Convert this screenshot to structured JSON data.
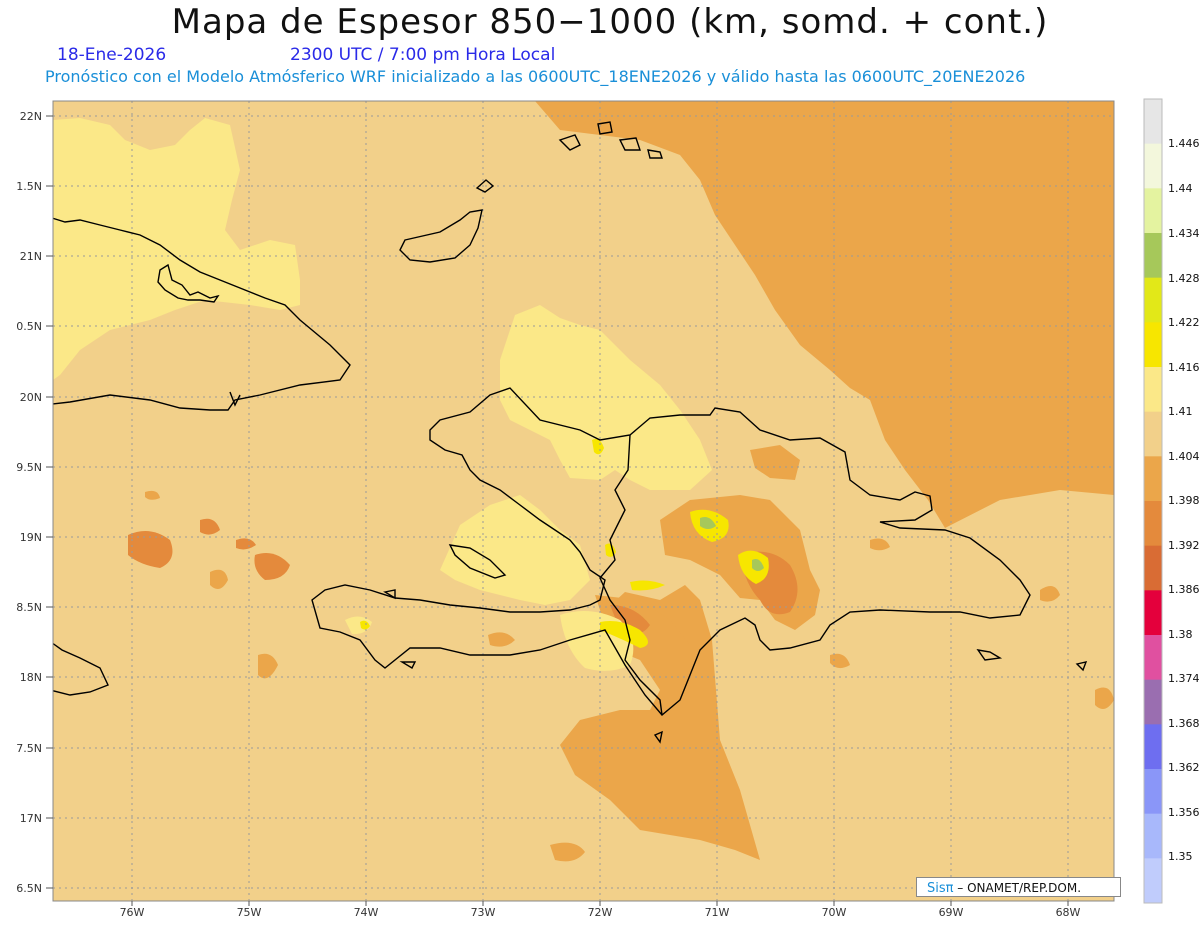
{
  "header": {
    "title": "Mapa de Espesor 850−1000 (km, somd. + cont.)",
    "date": "18-Ene-2026",
    "time": "2300 UTC / 7:00 pm Hora Local",
    "subtitle": "Pronóstico con el Modelo Atmósferico WRF inicializado a las 0600UTC_18ENE2026 y válido hasta las  0600UTC_20ENE2026"
  },
  "axes": {
    "lat_labels": [
      "22N",
      "1.5N",
      "21N",
      "0.5N",
      "20N",
      "9.5N",
      "19N",
      "8.5N",
      "18N",
      "7.5N",
      "17N",
      "6.5N"
    ],
    "lon_labels": [
      "76W",
      "75W",
      "74W",
      "73W",
      "72W",
      "71W",
      "70W",
      "69W",
      "68W"
    ]
  },
  "colorbar": {
    "labels": [
      "1.446",
      "1.44",
      "1.434",
      "1.428",
      "1.422",
      "1.416",
      "1.41",
      "1.404",
      "1.398",
      "1.392",
      "1.386",
      "1.38",
      "1.374",
      "1.368",
      "1.362",
      "1.356",
      "1.35"
    ],
    "colors": [
      "#e6e6e6",
      "#f3f7dc",
      "#e4f3a0",
      "#a6c85a",
      "#e2e818",
      "#f7e600",
      "#fbe888",
      "#f2d08a",
      "#eba64a",
      "#e48a3c",
      "#d96c34",
      "#e4003c",
      "#e050a0",
      "#9a6eb0",
      "#6e6ef0",
      "#8a96f8",
      "#a8b8fb",
      "#c0ccfc"
    ]
  },
  "map": {
    "colors": {
      "base": "#f2d08a",
      "high": "#fbe888",
      "low": "#eba64a",
      "lower": "#e48a3c",
      "lowest": "#d96c34",
      "peak_yellow": "#f7e600",
      "peak_green": "#a6c85a",
      "coast": "#000000",
      "grid": "#9a9a9a"
    }
  },
  "credit": {
    "logo": "Sisπ",
    "text": "– ONAMET/REP.DOM."
  }
}
